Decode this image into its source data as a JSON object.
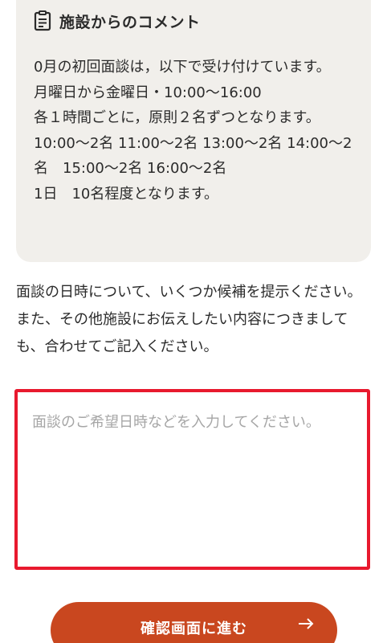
{
  "comment_card": {
    "title": "施設からのコメント",
    "icon": "memo-icon",
    "lines": [
      "0月の初回面談は，以下で受け付けています。",
      "月曜日から金曜日・10:00〜16:00",
      "各１時間ごとに，原則２名ずつとなります。",
      "10:00〜2名 11:00〜2名 13:00〜2名 14:00〜2名　15:00〜2名 16:00〜2名",
      "1日　10名程度となります。"
    ]
  },
  "instruction": {
    "line1": "面談の日時について、いくつか候補を提示ください。",
    "line2": "また、その他施設にお伝えしたい内容につきましても、合わせてご記入ください。"
  },
  "input": {
    "placeholder": "面談のご希望日時などを入力してください。",
    "value": ""
  },
  "confirm_button": {
    "label": "確認画面に進む",
    "icon": "arrow-right-icon"
  },
  "colors": {
    "card_bg": "#f1efeb",
    "highlight_border": "#e8192e",
    "button_bg": "#c9471f",
    "placeholder": "#a6a6a6"
  }
}
